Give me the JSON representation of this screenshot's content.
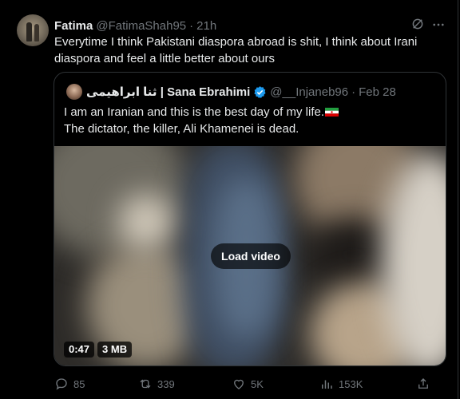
{
  "tweet": {
    "author_name": "Fatima",
    "author_handle": "@FatimaShah95",
    "separator": "·",
    "time": "21h",
    "text": "Everytime I think Pakistani diaspora abroad is shit, I think about Irani diaspora and feel a little better about ours"
  },
  "quote": {
    "author_name": "ثنا ابراهیمی | Sana Ebrahimi",
    "author_handle": "@__Injaneb96",
    "separator": "·",
    "date": "Feb 28",
    "line1": "I am an Iranian and this is the best day of my life.",
    "line2": "The dictator, the killer, Ali Khamenei is dead.",
    "flag_icon": "iran-flag-emoji",
    "video": {
      "load_label": "Load video",
      "duration": "0:47",
      "size": "3 MB"
    }
  },
  "actions": {
    "replies": "85",
    "reposts": "339",
    "likes": "5K",
    "views": "153K"
  },
  "colors": {
    "background": "#000000",
    "text": "#e7e9ea",
    "muted": "#71767b",
    "border": "#2f3336",
    "verified": "#1d9bf0"
  }
}
